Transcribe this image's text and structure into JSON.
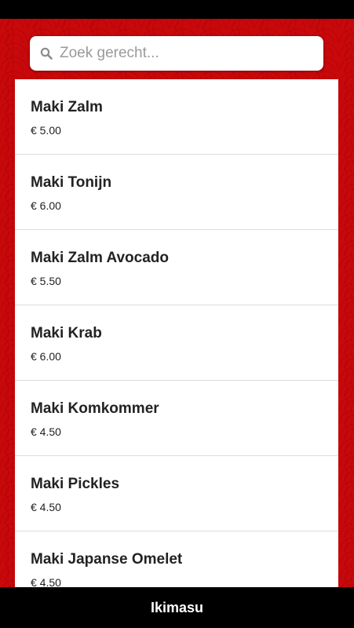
{
  "search": {
    "placeholder": "Zoek gerecht...",
    "icon": "search-icon"
  },
  "items": [
    {
      "name": "Maki Zalm",
      "price": "€ 5.00"
    },
    {
      "name": "Maki Tonijn",
      "price": "€ 6.00"
    },
    {
      "name": "Maki Zalm Avocado",
      "price": "€ 5.50"
    },
    {
      "name": "Maki Krab",
      "price": "€ 6.00"
    },
    {
      "name": "Maki Komkommer",
      "price": "€ 4.50"
    },
    {
      "name": "Maki Pickles",
      "price": "€ 4.50"
    },
    {
      "name": "Maki Japanse Omelet",
      "price": "€ 4.50"
    }
  ],
  "footer": {
    "title": "Ikimasu"
  },
  "colors": {
    "background": "#c8080b",
    "bars": "#000000"
  }
}
